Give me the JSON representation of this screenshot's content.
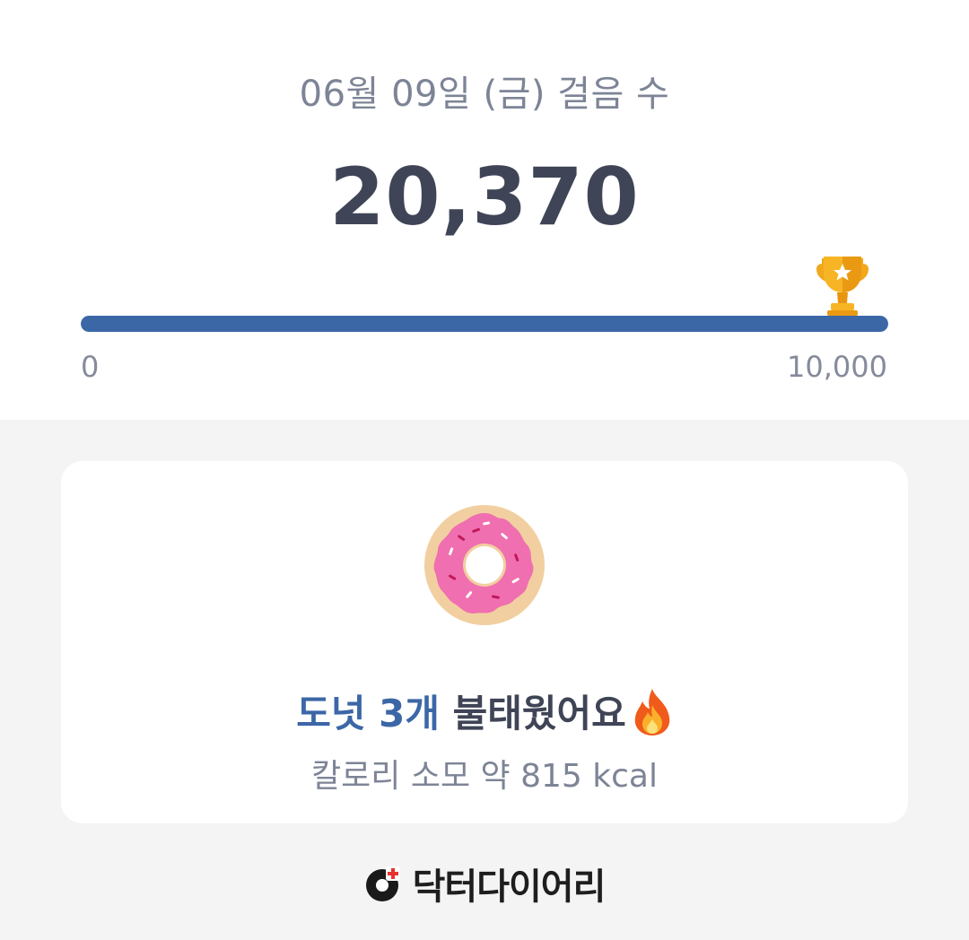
{
  "header": {
    "date_title": "06월 09일 (금) 걸음 수",
    "step_count": "20,370"
  },
  "progress": {
    "min_label": "0",
    "max_label": "10,000",
    "fill_fraction": 1.0,
    "trophy_icon": "trophy-icon",
    "fill_color": "#3c67a7"
  },
  "card": {
    "donut_icon": "donut-icon",
    "headline_accent": "도넛 3개",
    "headline_rest": " 불태웠어요",
    "fire_icon": "fire-icon",
    "subtext": "칼로리 소모 약 815 kcal"
  },
  "brand": {
    "logo_icon": "doctor-diary-logo-icon",
    "name": "닥터다이어리"
  }
}
